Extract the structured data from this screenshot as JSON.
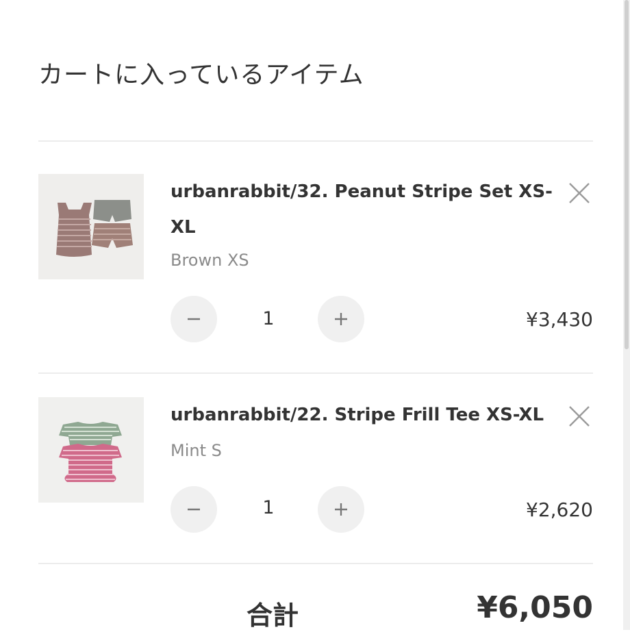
{
  "page": {
    "title": "カートに入っているアイテム"
  },
  "items": [
    {
      "name": "urbanrabbit/32. Peanut Stripe Set XS-XL",
      "variant": "Brown XS",
      "quantity": "1",
      "price": "¥3,430",
      "decrease_label": "−",
      "increase_label": "+"
    },
    {
      "name": "urbanrabbit/22. Stripe Frill Tee XS-XL",
      "variant": "Mint S",
      "quantity": "1",
      "price": "¥2,620",
      "decrease_label": "−",
      "increase_label": "+"
    }
  ],
  "summary": {
    "total_label": "合計",
    "total_value": "¥6,050"
  },
  "icons": {
    "remove": "close-icon",
    "decrease": "minus-icon",
    "increase": "plus-icon"
  },
  "colors": {
    "text": "#333333",
    "muted": "#8a8a8a",
    "button_bg": "#f0f0f0",
    "divider": "#ececec"
  }
}
